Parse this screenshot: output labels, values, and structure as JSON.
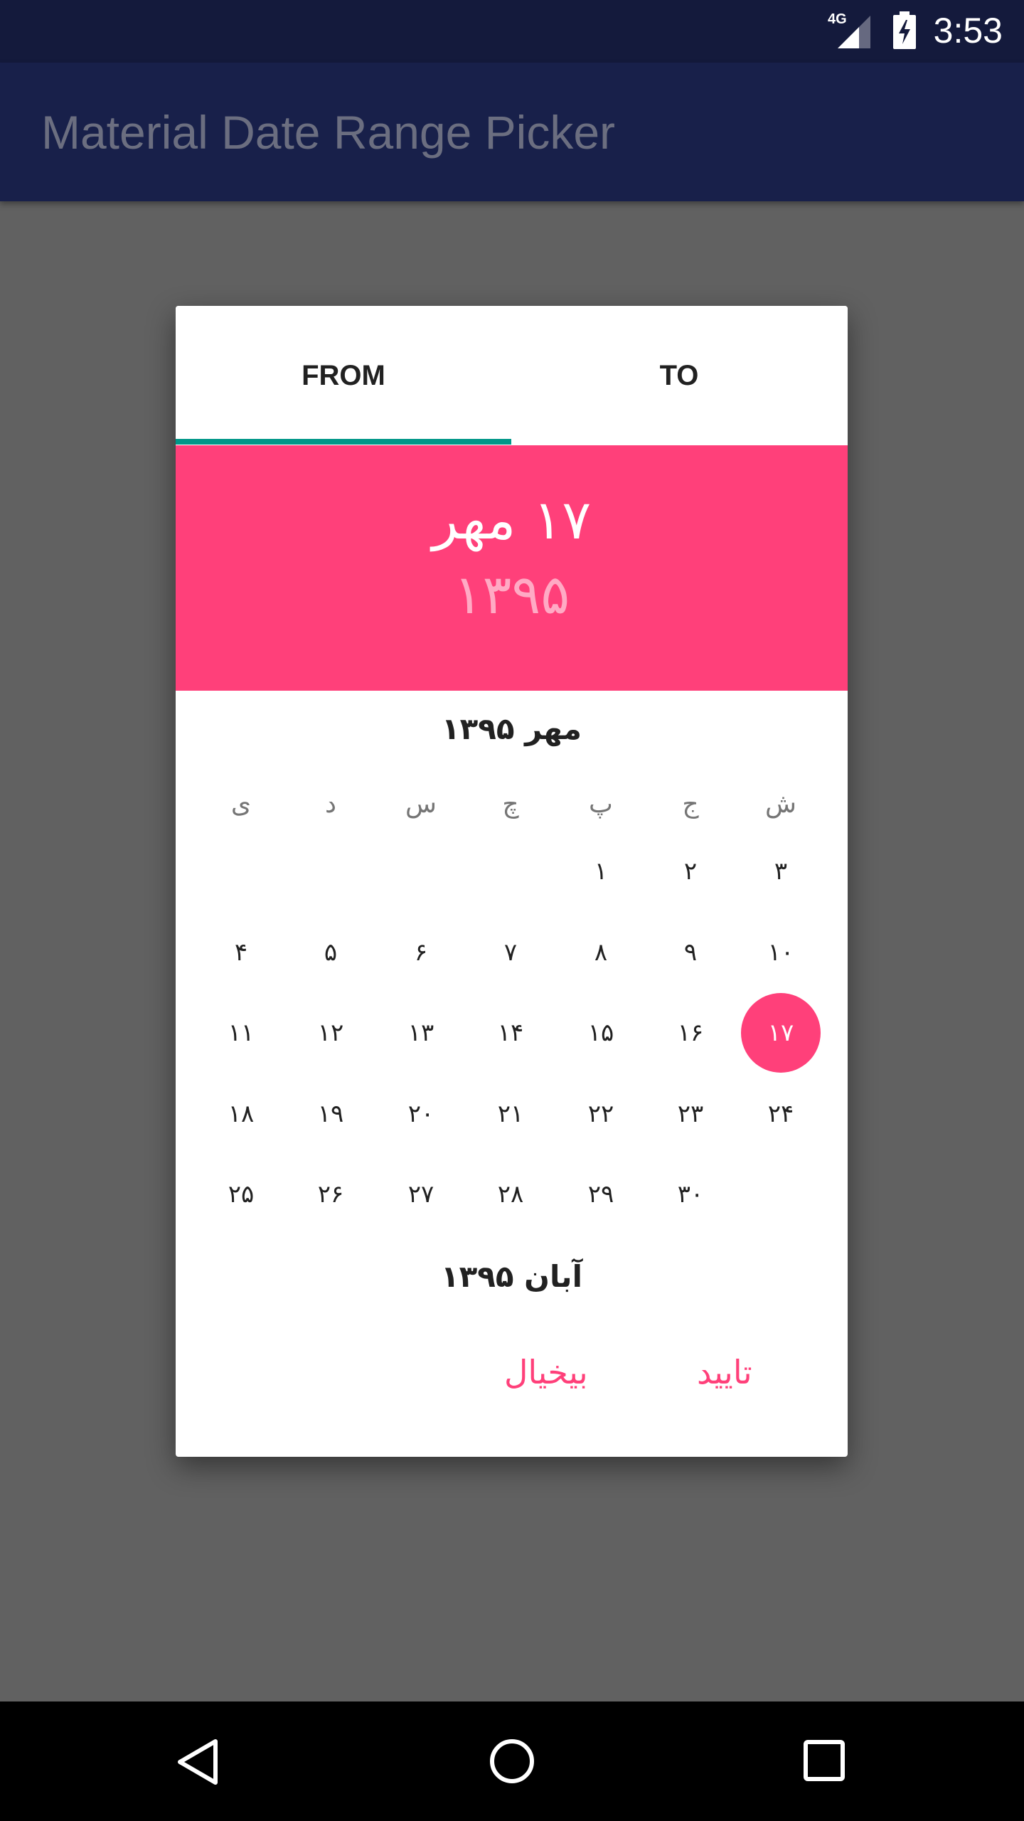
{
  "status_bar": {
    "time": "3:53",
    "network": "4G",
    "icons": [
      "signal-icon",
      "battery-charging-icon"
    ]
  },
  "app_bar": {
    "title": "Material Date Range Picker"
  },
  "dialog": {
    "tabs": [
      {
        "label": "FROM",
        "selected": true
      },
      {
        "label": "TO",
        "selected": false
      }
    ],
    "header": {
      "date": "۱۷ مهر",
      "year": "۱۳۹۵"
    },
    "month_title": "مهر ۱۳۹۵",
    "weekdays": [
      "ش",
      "ج",
      "پ",
      "چ",
      "س",
      "د",
      "ی"
    ],
    "weeks": [
      [
        "۳",
        "۲",
        "۱",
        "",
        "",
        "",
        ""
      ],
      [
        "۱۰",
        "۹",
        "۸",
        "۷",
        "۶",
        "۵",
        "۴"
      ],
      [
        "۱۷",
        "۱۶",
        "۱۵",
        "۱۴",
        "۱۳",
        "۱۲",
        "۱۱"
      ],
      [
        "۲۴",
        "۲۳",
        "۲۲",
        "۲۱",
        "۲۰",
        "۱۹",
        "۱۸"
      ],
      [
        "",
        "۳۰",
        "۲۹",
        "۲۸",
        "۲۷",
        "۲۶",
        "۲۵"
      ]
    ],
    "selected_day": "۱۷",
    "next_month_title": "آبان ۱۳۹۵",
    "buttons": {
      "ok": "تایید",
      "cancel": "بیخیال"
    }
  },
  "colors": {
    "accent": "#ff407a",
    "tab_indicator": "#009688",
    "app_bar": "#18204a",
    "status_bar": "#141a3c",
    "scrim": "#616161"
  },
  "nav_bar": {
    "icons": [
      "back-icon",
      "home-icon",
      "recents-icon"
    ]
  }
}
